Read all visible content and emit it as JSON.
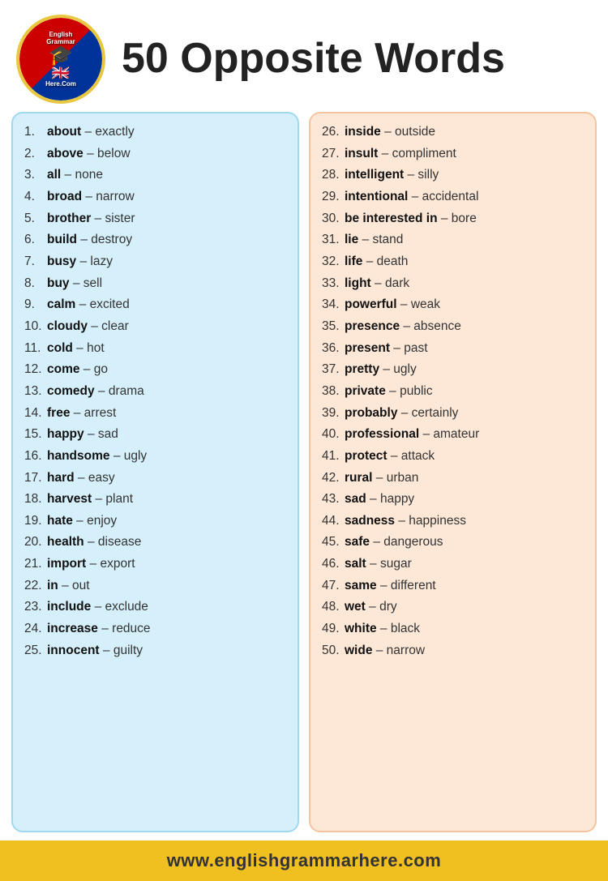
{
  "header": {
    "title": "50 Opposite Words",
    "logo_top": "English Grammar",
    "logo_bottom": "Here.Com"
  },
  "left_list": [
    {
      "num": "1.",
      "word": "about",
      "opposite": "exactly"
    },
    {
      "num": "2.",
      "word": "above",
      "opposite": "below"
    },
    {
      "num": "3.",
      "word": "all",
      "opposite": "none"
    },
    {
      "num": "4.",
      "word": "broad",
      "opposite": "narrow"
    },
    {
      "num": "5.",
      "word": "brother",
      "opposite": "sister"
    },
    {
      "num": "6.",
      "word": "build",
      "opposite": "destroy"
    },
    {
      "num": "7.",
      "word": "busy",
      "opposite": "lazy"
    },
    {
      "num": "8.",
      "word": "buy",
      "opposite": "sell"
    },
    {
      "num": "9.",
      "word": "calm",
      "opposite": "excited"
    },
    {
      "num": "10.",
      "word": "cloudy",
      "opposite": "clear"
    },
    {
      "num": "11.",
      "word": "cold",
      "opposite": "hot"
    },
    {
      "num": "12.",
      "word": "come",
      "opposite": "go"
    },
    {
      "num": "13.",
      "word": "comedy",
      "opposite": "drama"
    },
    {
      "num": "14.",
      "word": "free",
      "opposite": "arrest"
    },
    {
      "num": "15.",
      "word": "happy",
      "opposite": "sad"
    },
    {
      "num": "16.",
      "word": "handsome",
      "opposite": "ugly"
    },
    {
      "num": "17.",
      "word": "hard",
      "opposite": "easy"
    },
    {
      "num": "18.",
      "word": "harvest",
      "opposite": "plant"
    },
    {
      "num": "19.",
      "word": "hate",
      "opposite": "enjoy"
    },
    {
      "num": "20.",
      "word": "health",
      "opposite": "disease"
    },
    {
      "num": "21.",
      "word": "import",
      "opposite": "export"
    },
    {
      "num": "22.",
      "word": "in",
      "opposite": "out"
    },
    {
      "num": "23.",
      "word": "include",
      "opposite": "exclude"
    },
    {
      "num": "24.",
      "word": "increase",
      "opposite": "reduce"
    },
    {
      "num": "25.",
      "word": "innocent",
      "opposite": "guilty"
    }
  ],
  "right_list": [
    {
      "num": "26.",
      "word": "inside",
      "opposite": "outside"
    },
    {
      "num": "27.",
      "word": "insult",
      "opposite": "compliment"
    },
    {
      "num": "28.",
      "word": "intelligent",
      "opposite": "silly"
    },
    {
      "num": "29.",
      "word": "intentional",
      "opposite": "accidental"
    },
    {
      "num": "30.",
      "word": "be interested in",
      "opposite": "bore"
    },
    {
      "num": "31.",
      "word": "lie",
      "opposite": "stand"
    },
    {
      "num": "32.",
      "word": "life",
      "opposite": "death"
    },
    {
      "num": "33.",
      "word": "light",
      "opposite": "dark"
    },
    {
      "num": "34.",
      "word": "powerful",
      "opposite": "weak"
    },
    {
      "num": "35.",
      "word": "presence",
      "opposite": "absence"
    },
    {
      "num": "36.",
      "word": "present",
      "opposite": "past"
    },
    {
      "num": "37.",
      "word": "pretty",
      "opposite": "ugly"
    },
    {
      "num": "38.",
      "word": "private",
      "opposite": "public"
    },
    {
      "num": "39.",
      "word": "probably",
      "opposite": "certainly"
    },
    {
      "num": "40.",
      "word": "professional",
      "opposite": "amateur"
    },
    {
      "num": "41.",
      "word": "protect",
      "opposite": "attack"
    },
    {
      "num": "42.",
      "word": "rural",
      "opposite": "urban"
    },
    {
      "num": "43.",
      "word": "sad",
      "opposite": "happy"
    },
    {
      "num": "44.",
      "word": "sadness",
      "opposite": "happiness"
    },
    {
      "num": "45.",
      "word": "safe",
      "opposite": "dangerous"
    },
    {
      "num": "46.",
      "word": "salt",
      "opposite": "sugar"
    },
    {
      "num": "47.",
      "word": "same",
      "opposite": "different"
    },
    {
      "num": "48.",
      "word": "wet",
      "opposite": "dry"
    },
    {
      "num": "49.",
      "word": "white",
      "opposite": "black"
    },
    {
      "num": "50.",
      "word": "wide",
      "opposite": "narrow"
    }
  ],
  "footer": {
    "url": "www.englishgrammarhere.com"
  }
}
